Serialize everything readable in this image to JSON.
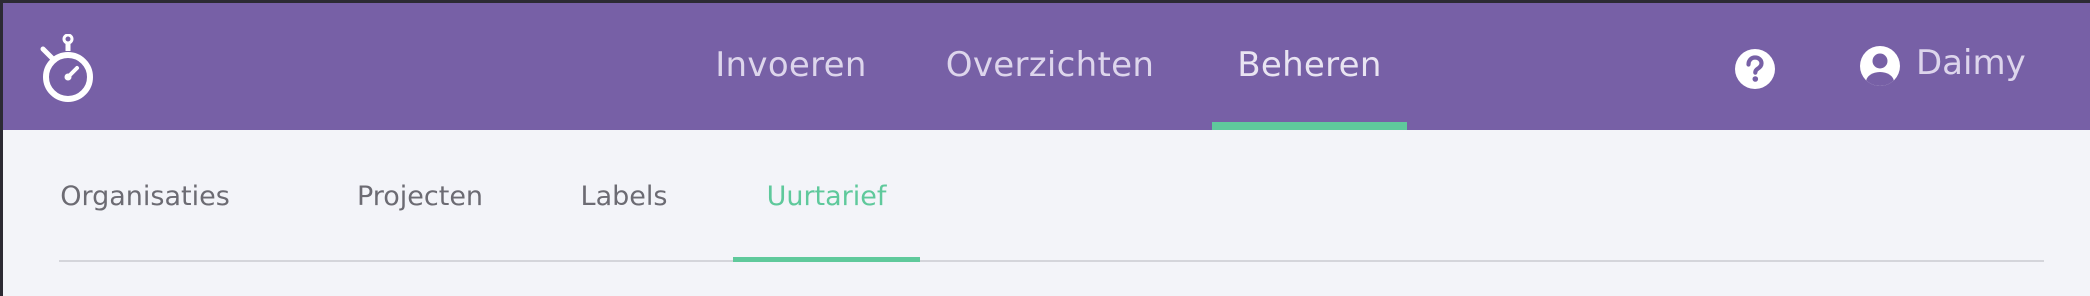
{
  "colors": {
    "header_bg": "#7760a6",
    "accent": "#5fc99c",
    "page_bg": "#f3f4f9",
    "nav_text": "#ddd5ec",
    "subnav_text": "#6c6b73"
  },
  "header": {
    "logo_icon": "stopwatch-icon",
    "nav": [
      {
        "label": "Invoeren",
        "active": false
      },
      {
        "label": "Overzichten",
        "active": false
      },
      {
        "label": "Beheren",
        "active": true
      }
    ],
    "help_icon": "help-circle-icon",
    "user": {
      "icon": "user-avatar-icon",
      "name": "Daimy"
    }
  },
  "subnav": {
    "tabs": [
      {
        "label": "Organisaties",
        "active": false
      },
      {
        "label": "Projecten",
        "active": false
      },
      {
        "label": "Labels",
        "active": false
      },
      {
        "label": "Uurtarief",
        "active": true
      }
    ]
  }
}
